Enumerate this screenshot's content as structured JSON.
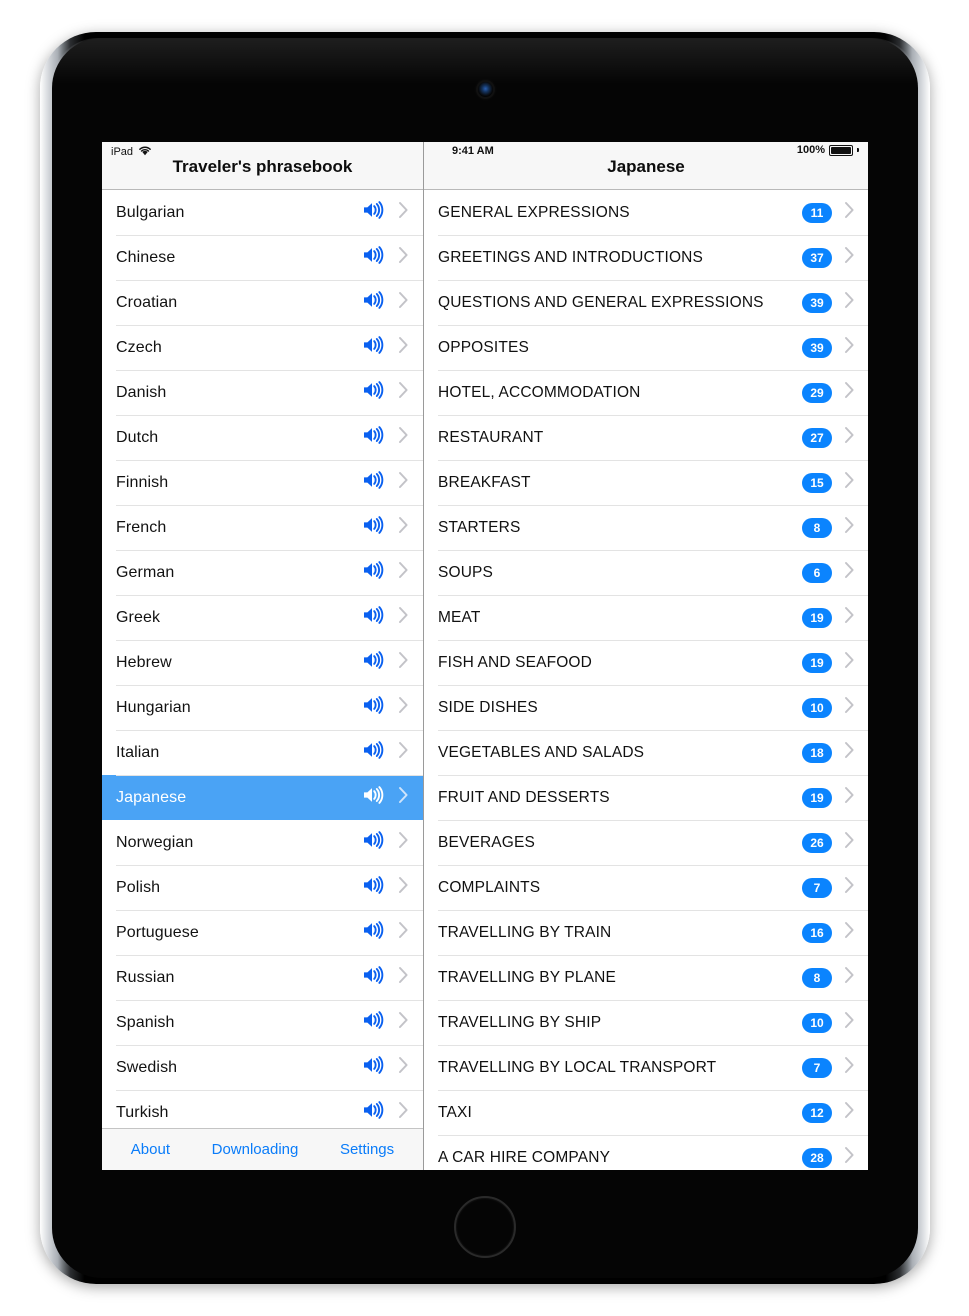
{
  "device": {
    "name": "iPad",
    "camera_icon": "front-camera",
    "home_button_icon": "home-button"
  },
  "status_bar": {
    "carrier_label": "iPad",
    "wifi_icon": "wifi-icon",
    "time": "9:41 AM",
    "battery_percent": "100%",
    "battery_icon": "battery-full-icon"
  },
  "left_pane": {
    "title": "Traveler's phrasebook",
    "speaker_icon": "speaker-icon",
    "disclosure_icon": "chevron-right-icon",
    "selected_language": "Japanese",
    "languages": [
      {
        "name": "Bulgarian"
      },
      {
        "name": "Chinese"
      },
      {
        "name": "Croatian"
      },
      {
        "name": "Czech"
      },
      {
        "name": "Danish"
      },
      {
        "name": "Dutch"
      },
      {
        "name": "Finnish"
      },
      {
        "name": "French"
      },
      {
        "name": "German"
      },
      {
        "name": "Greek"
      },
      {
        "name": "Hebrew"
      },
      {
        "name": "Hungarian"
      },
      {
        "name": "Italian"
      },
      {
        "name": "Japanese"
      },
      {
        "name": "Norwegian"
      },
      {
        "name": "Polish"
      },
      {
        "name": "Portuguese"
      },
      {
        "name": "Russian"
      },
      {
        "name": "Spanish"
      },
      {
        "name": "Swedish"
      },
      {
        "name": "Turkish"
      }
    ],
    "toolbar": {
      "about_label": "About",
      "downloading_label": "Downloading",
      "settings_label": "Settings"
    }
  },
  "right_pane": {
    "title": "Japanese",
    "disclosure_icon": "chevron-right-icon",
    "categories": [
      {
        "name": "GENERAL EXPRESSIONS",
        "count": "11"
      },
      {
        "name": "GREETINGS AND INTRODUCTIONS",
        "count": "37"
      },
      {
        "name": "QUESTIONS AND GENERAL EXPRESSIONS",
        "count": "39"
      },
      {
        "name": "OPPOSITES",
        "count": "39"
      },
      {
        "name": "HOTEL, ACCOMMODATION",
        "count": "29"
      },
      {
        "name": "RESTAURANT",
        "count": "27"
      },
      {
        "name": "BREAKFAST",
        "count": "15"
      },
      {
        "name": "STARTERS",
        "count": "8"
      },
      {
        "name": "SOUPS",
        "count": "6"
      },
      {
        "name": "MEAT",
        "count": "19"
      },
      {
        "name": "FISH AND SEAFOOD",
        "count": "19"
      },
      {
        "name": "SIDE DISHES",
        "count": "10"
      },
      {
        "name": "VEGETABLES AND SALADS",
        "count": "18"
      },
      {
        "name": "FRUIT AND DESSERTS",
        "count": "19"
      },
      {
        "name": "BEVERAGES",
        "count": "26"
      },
      {
        "name": "COMPLAINTS",
        "count": "7"
      },
      {
        "name": "TRAVELLING BY TRAIN",
        "count": "16"
      },
      {
        "name": "TRAVELLING BY PLANE",
        "count": "8"
      },
      {
        "name": "TRAVELLING BY SHIP",
        "count": "10"
      },
      {
        "name": "TRAVELLING BY LOCAL TRANSPORT",
        "count": "7"
      },
      {
        "name": "TAXI",
        "count": "12"
      },
      {
        "name": "A CAR HIRE COMPANY",
        "count": "28"
      }
    ]
  },
  "colors": {
    "accent_blue": "#0b84fe",
    "selection_blue": "#4aa3f5",
    "speaker_blue": "#0a60f0",
    "header_gray": "#f7f7f7"
  }
}
